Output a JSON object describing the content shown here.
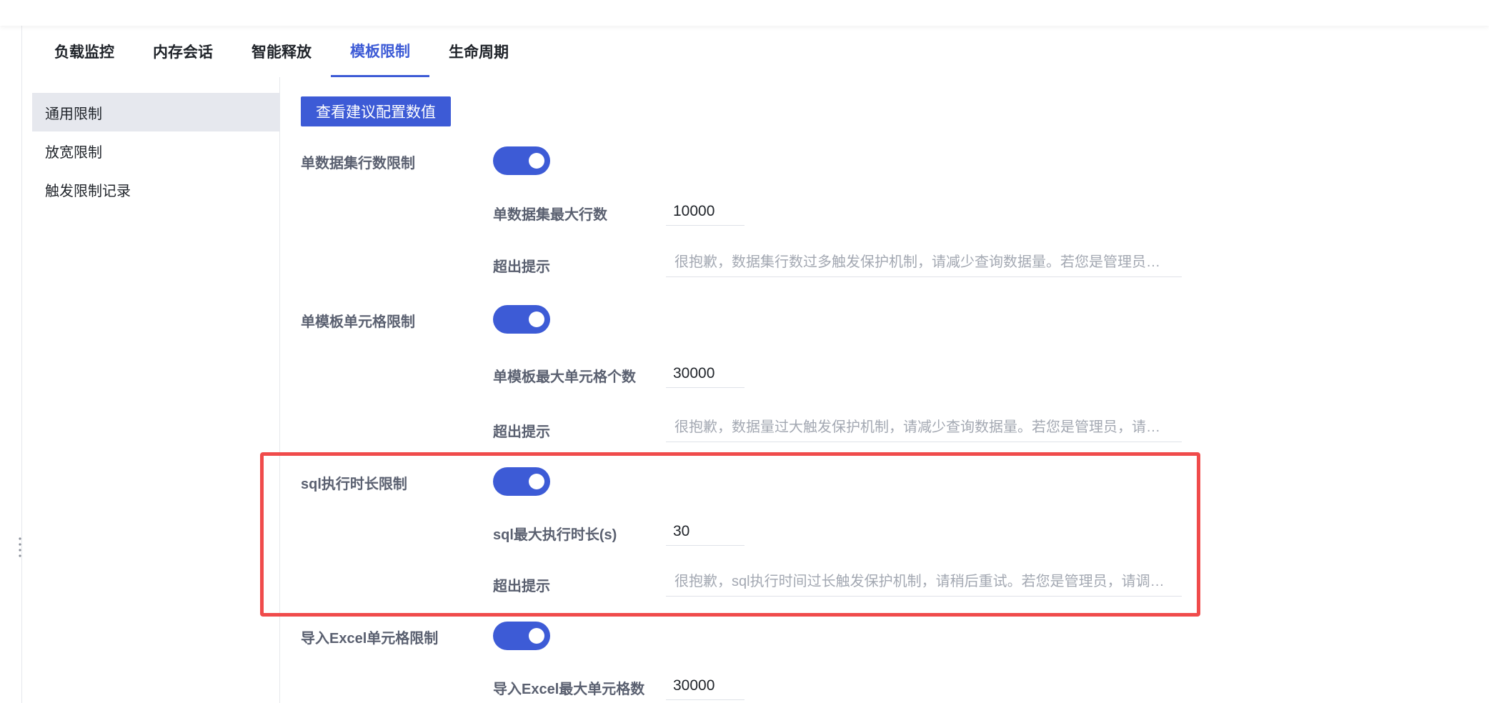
{
  "tabs": [
    {
      "label": "负载监控"
    },
    {
      "label": "内存会话"
    },
    {
      "label": "智能释放"
    },
    {
      "label": "模板限制",
      "active": true
    },
    {
      "label": "生命周期"
    }
  ],
  "sidenav": {
    "items": [
      {
        "label": "通用限制",
        "selected": true
      },
      {
        "label": "放宽限制"
      },
      {
        "label": "触发限制记录"
      }
    ]
  },
  "toolbar": {
    "view_suggested_label": "查看建议配置数值"
  },
  "limits": [
    {
      "title": "单数据集行数限制",
      "enabled": true,
      "max_label": "单数据集最大行数",
      "max_value": "10000",
      "hint_label": "超出提示",
      "hint_placeholder": "很抱歉，数据集行数过多触发保护机制，请减少查询数据量。若您是管理员，请调整模板限制配置。"
    },
    {
      "title": "单模板单元格限制",
      "enabled": true,
      "max_label": "单模板最大单元格个数",
      "max_value": "30000",
      "hint_label": "超出提示",
      "hint_placeholder": "很抱歉，数据量过大触发保护机制，请减少查询数据量。若您是管理员，请调整模板限制配置。"
    },
    {
      "title": "sql执行时长限制",
      "enabled": true,
      "max_label": "sql最大执行时长(s)",
      "max_value": "30",
      "hint_label": "超出提示",
      "hint_placeholder": "很抱歉，sql执行时间过长触发保护机制，请稍后重试。若您是管理员，请调整模板限制配置。"
    },
    {
      "title": "导入Excel单元格限制",
      "enabled": true,
      "max_label": "导入Excel最大单元格数",
      "max_value": "30000"
    }
  ],
  "colors": {
    "accent": "#3d5bd6",
    "highlight": "#f04b4b"
  }
}
